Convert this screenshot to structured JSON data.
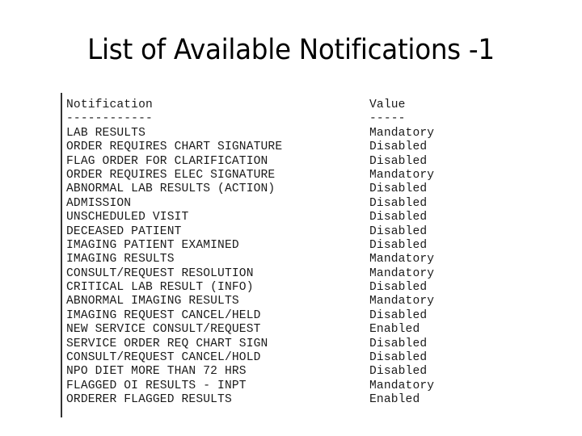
{
  "title": "List of Available Notifications -1",
  "table": {
    "header": {
      "name": "Notification",
      "value": "Value"
    },
    "separator": {
      "name": "------------",
      "value": "-----"
    },
    "rows": [
      {
        "name": "LAB RESULTS",
        "value": "Mandatory"
      },
      {
        "name": "ORDER REQUIRES CHART SIGNATURE",
        "value": "Disabled"
      },
      {
        "name": "FLAG ORDER FOR CLARIFICATION",
        "value": "Disabled"
      },
      {
        "name": "ORDER REQUIRES ELEC SIGNATURE",
        "value": "Mandatory"
      },
      {
        "name": "ABNORMAL LAB RESULTS (ACTION)",
        "value": "Disabled"
      },
      {
        "name": "ADMISSION",
        "value": "Disabled"
      },
      {
        "name": "UNSCHEDULED VISIT",
        "value": "Disabled"
      },
      {
        "name": "DECEASED PATIENT",
        "value": "Disabled"
      },
      {
        "name": "IMAGING PATIENT EXAMINED",
        "value": "Disabled"
      },
      {
        "name": "IMAGING RESULTS",
        "value": "Mandatory"
      },
      {
        "name": "CONSULT/REQUEST RESOLUTION",
        "value": "Mandatory"
      },
      {
        "name": "CRITICAL LAB RESULT (INFO)",
        "value": "Disabled"
      },
      {
        "name": "ABNORMAL IMAGING RESULTS",
        "value": "Mandatory"
      },
      {
        "name": "IMAGING REQUEST CANCEL/HELD",
        "value": "Disabled"
      },
      {
        "name": "NEW SERVICE CONSULT/REQUEST",
        "value": "Enabled"
      },
      {
        "name": "SERVICE ORDER REQ CHART SIGN",
        "value": "Disabled"
      },
      {
        "name": "CONSULT/REQUEST CANCEL/HOLD",
        "value": "Disabled"
      },
      {
        "name": "NPO DIET MORE THAN 72 HRS",
        "value": "Disabled"
      },
      {
        "name": "FLAGGED OI RESULTS - INPT",
        "value": "Mandatory"
      },
      {
        "name": "ORDERER FLAGGED RESULTS",
        "value": "Enabled"
      }
    ]
  }
}
